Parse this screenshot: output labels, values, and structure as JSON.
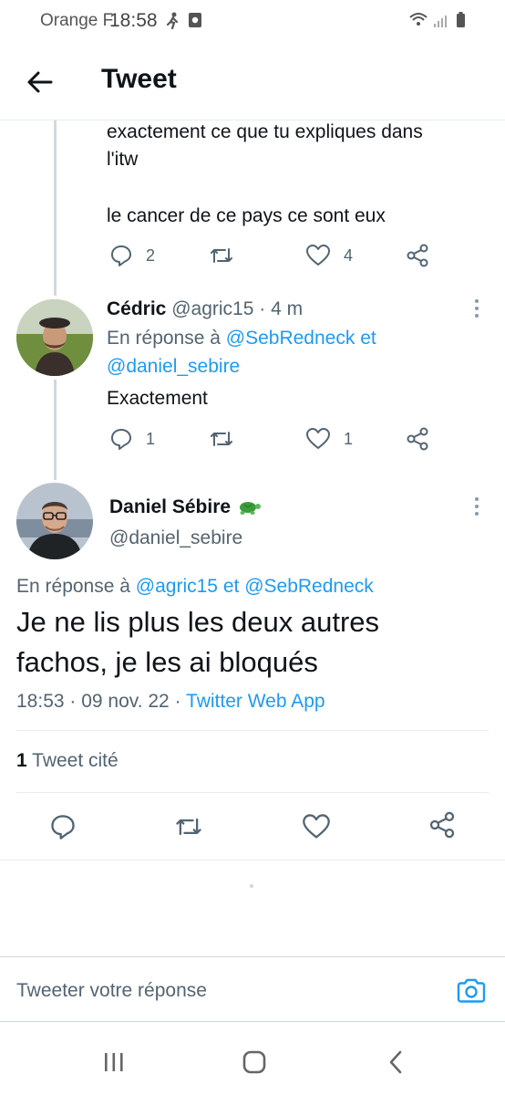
{
  "status_bar": {
    "carrier": "Orange F",
    "time": "18:58"
  },
  "header": {
    "title": "Tweet"
  },
  "previous_tweet": {
    "lines": [
      "exactement ce que tu expliques dans",
      "l'itw",
      "le cancer de ce pays ce sont eux"
    ],
    "reply_count": "2",
    "like_count": "4"
  },
  "reply_tweet": {
    "display_name": "Cédric",
    "handle": "@agric15",
    "time_ago": "· 4 m",
    "in_reply_prefix": "En réponse à",
    "mention_1": "@SebRedneck",
    "and_word": "et",
    "mention_2": "@daniel_sebire",
    "text": "Exactement",
    "reply_count": "1",
    "like_count": "1"
  },
  "main_tweet": {
    "display_name": "Daniel Sébire",
    "name_emoji": "🐢",
    "handle": "@daniel_sebire",
    "in_reply_prefix": "En réponse à",
    "mention_1": "@agric15",
    "and_word": "et",
    "mention_2": "@SebRedneck",
    "text_line_1": "Je ne lis plus les deux autres",
    "text_line_2": "fachos, je les ai bloqués",
    "timestamp": "18:53 · 09 nov. 22 ·",
    "source_app": "Twitter Web App",
    "quote_count": "1",
    "quote_label": "Tweet cité"
  },
  "reply_composer": {
    "placeholder": "Tweeter votre réponse"
  },
  "colors": {
    "link": "#1d9bf0",
    "muted": "#536471",
    "icon": "#536471",
    "turtle": "#3a9d3a"
  }
}
